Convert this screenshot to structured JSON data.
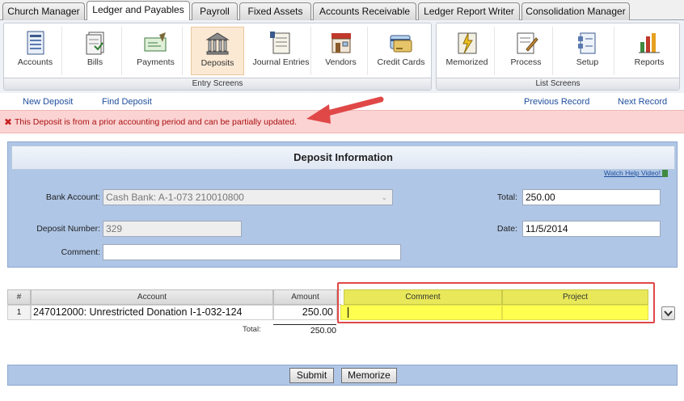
{
  "tabs": [
    "Church Manager",
    "Ledger and Payables",
    "Payroll",
    "Fixed Assets",
    "Accounts Receivable",
    "Ledger Report Writer",
    "Consolidation Manager"
  ],
  "active_tab": "Ledger and Payables",
  "ribbon": {
    "entry_group_label": "Entry Screens",
    "list_group_label": "List Screens",
    "entry_items": [
      "Accounts",
      "Bills",
      "Payments",
      "Deposits",
      "Journal Entries",
      "Vendors",
      "Credit Cards"
    ],
    "list_items": [
      "Memorized",
      "Process",
      "Setup",
      "Reports"
    ],
    "active_item": "Deposits"
  },
  "links": {
    "new_deposit": "New Deposit",
    "find_deposit": "Find Deposit",
    "previous_record": "Previous Record",
    "next_record": "Next Record"
  },
  "warning": "This Deposit is from a prior accounting period and can be partially updated.",
  "deposit_info": {
    "title": "Deposit Information",
    "help_video": "Watch Help Video!",
    "bank_account_label": "Bank Account:",
    "bank_account_value": "Cash Bank: A-1-073 210010800",
    "deposit_number_label": "Deposit Number:",
    "deposit_number_value": "329",
    "comment_label": "Comment:",
    "comment_value": "",
    "total_label": "Total:",
    "total_value": "250.00",
    "date_label": "Date:",
    "date_value": "11/5/2014"
  },
  "grid": {
    "headers": {
      "num": "#",
      "account": "Account",
      "amount": "Amount",
      "comment": "Comment",
      "project": "Project"
    },
    "rows": [
      {
        "num": "1",
        "account": "247012000: Unrestricted Donation I-1-032-124",
        "amount": "250.00",
        "comment": "",
        "project": ""
      }
    ],
    "total_label": "Total:",
    "total_value": "250.00"
  },
  "buttons": {
    "submit": "Submit",
    "memorize": "Memorize"
  },
  "colors": {
    "warning_bg": "#fbd3d3",
    "panel_bg": "#afc6e6",
    "highlight": "#ffff4f",
    "annotation": "#e04848"
  }
}
